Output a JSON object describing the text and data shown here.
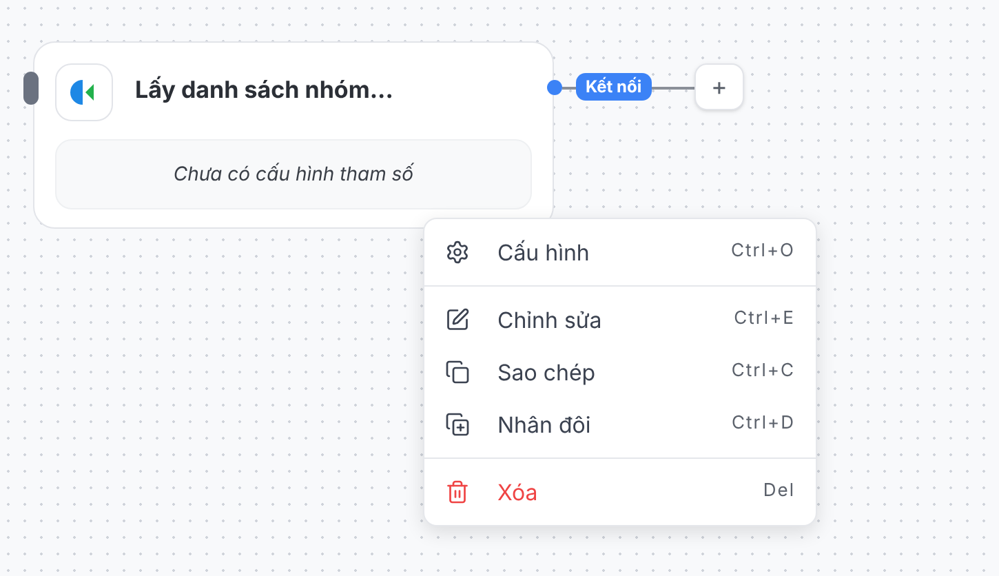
{
  "node": {
    "title": "Lấy danh sách nhóm...",
    "params_placeholder": "Chưa có cấu hình tham số"
  },
  "connection": {
    "label": "Kết nối",
    "add_symbol": "+"
  },
  "context_menu": {
    "groups": [
      [
        {
          "kind": "settings",
          "label": "Cấu hình",
          "shortcut": "Ctrl+O",
          "danger": false
        }
      ],
      [
        {
          "kind": "edit",
          "label": "Chỉnh sửa",
          "shortcut": "Ctrl+E",
          "danger": false
        },
        {
          "kind": "copy",
          "label": "Sao chép",
          "shortcut": "Ctrl+C",
          "danger": false
        },
        {
          "kind": "duplicate",
          "label": "Nhân đôi",
          "shortcut": "Ctrl+D",
          "danger": false
        }
      ],
      [
        {
          "kind": "delete",
          "label": "Xóa",
          "shortcut": "Del",
          "danger": true
        }
      ]
    ]
  }
}
